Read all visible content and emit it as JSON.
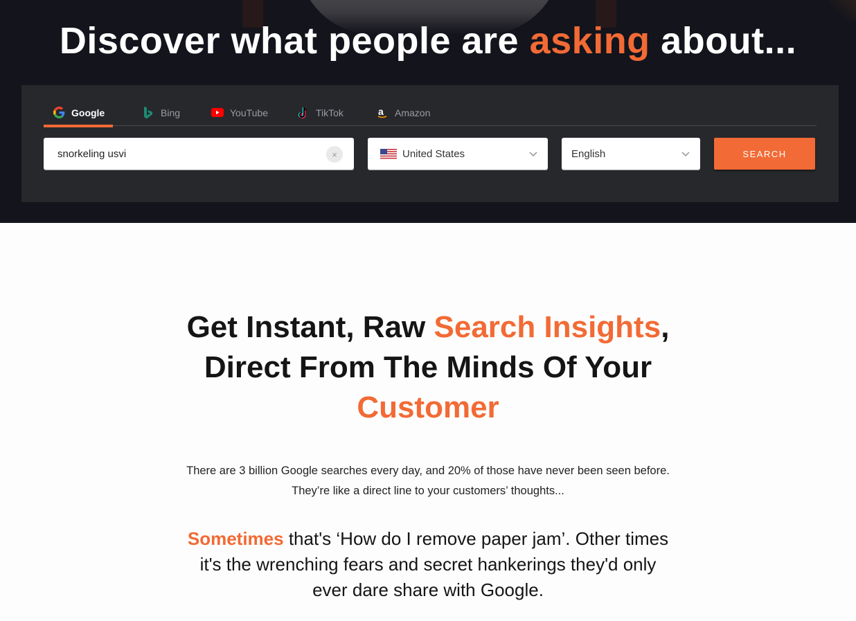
{
  "hero": {
    "title_prefix": "Discover what people are ",
    "title_accent": "asking",
    "title_suffix": " about..."
  },
  "colors": {
    "accent": "#f26a35",
    "hero_bg": "#13141c",
    "panel_bg": "#27282c"
  },
  "tabs": [
    {
      "label": "Google",
      "icon": "google-icon",
      "active": true
    },
    {
      "label": "Bing",
      "icon": "bing-icon",
      "active": false
    },
    {
      "label": "YouTube",
      "icon": "youtube-icon",
      "active": false
    },
    {
      "label": "TikTok",
      "icon": "tiktok-icon",
      "active": false
    },
    {
      "label": "Amazon",
      "icon": "amazon-icon",
      "active": false
    }
  ],
  "search": {
    "value": "snorkeling usvi",
    "clear_label": "×",
    "country": "United States",
    "country_icon": "us-flag-icon",
    "language": "English",
    "button_label": "SEARCH"
  },
  "content": {
    "headline_1": "Get Instant, Raw ",
    "headline_accent_1": "Search Insights",
    "headline_2": ",",
    "headline_3": "Direct From The Minds Of Your",
    "headline_accent_2": "Customer",
    "intro_line_1": "There are 3 billion Google searches every day, and 20% of those have never been seen before.",
    "intro_line_2": "They’re like a direct line to your customers’ thoughts...",
    "quote_accent": "Sometimes",
    "quote_line_1": " that's ‘How do I remove paper jam’. Other times",
    "quote_line_2": "it's the wrenching fears and secret hankerings they'd only",
    "quote_line_3": "ever dare share with Google."
  }
}
